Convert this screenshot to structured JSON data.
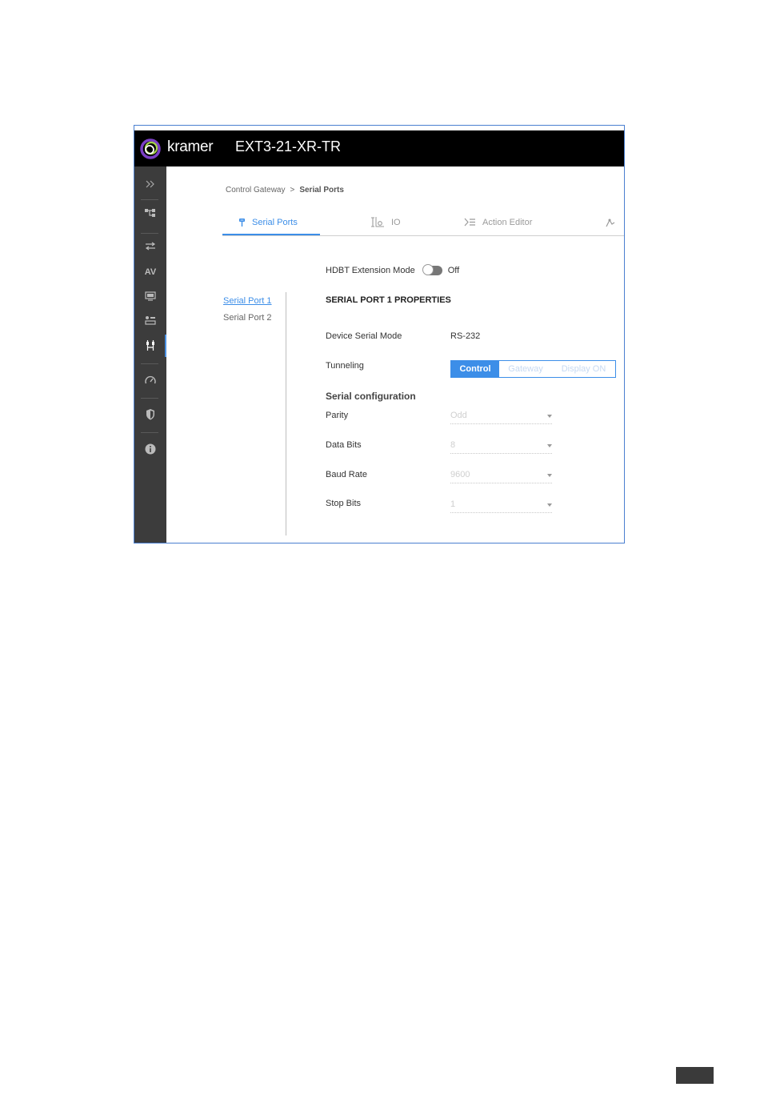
{
  "header": {
    "brand": "kramer",
    "device_name": "EXT3-21-XR-TR"
  },
  "sidebar": {
    "items": [
      {
        "icon": "expand-chevrons-icon"
      },
      {
        "icon": "routing-icon"
      },
      {
        "icon": "auto-switching-icon"
      },
      {
        "icon": "av-settings-icon",
        "label": "AV"
      },
      {
        "icon": "edid-icon"
      },
      {
        "icon": "cec-icon"
      },
      {
        "icon": "control-gateway-icon",
        "active": true
      },
      {
        "icon": "device-settings-icon"
      },
      {
        "icon": "security-shield-icon"
      },
      {
        "icon": "about-info-icon"
      }
    ]
  },
  "breadcrumb": {
    "parent": "Control Gateway",
    "separator": ">",
    "current": "Serial Ports"
  },
  "tabs": [
    {
      "label": "Serial Ports",
      "icon": "serial-port-icon",
      "active": true
    },
    {
      "label": "IO",
      "icon": "io-icon",
      "active": false
    },
    {
      "label": "Action Editor",
      "icon": "action-editor-icon",
      "active": false
    },
    {
      "icon": "next-tab-icon"
    }
  ],
  "hdbt": {
    "label": "HDBT Extension Mode",
    "state": "Off"
  },
  "ports": [
    {
      "label": "Serial Port 1",
      "active": true
    },
    {
      "label": "Serial Port 2",
      "active": false
    }
  ],
  "properties": {
    "title": "SERIAL PORT 1 PROPERTIES",
    "device_serial_mode_label": "Device Serial Mode",
    "device_serial_mode_value": "RS-232",
    "tunneling_label": "Tunneling",
    "tunneling_options": [
      "Control",
      "Gateway",
      "Display ON"
    ],
    "tunneling_selected": "Control",
    "serial_config_heading": "Serial configuration",
    "parity_label": "Parity",
    "parity_value": "Odd",
    "data_bits_label": "Data Bits",
    "data_bits_value": "8",
    "baud_rate_label": "Baud Rate",
    "baud_rate_value": "9600",
    "stop_bits_label": "Stop Bits",
    "stop_bits_value": "1"
  },
  "colors": {
    "accent": "#3c8ee8",
    "topbar": "#000000",
    "sidebar": "#3c3c3c",
    "frame_border": "#4a7fd0"
  }
}
